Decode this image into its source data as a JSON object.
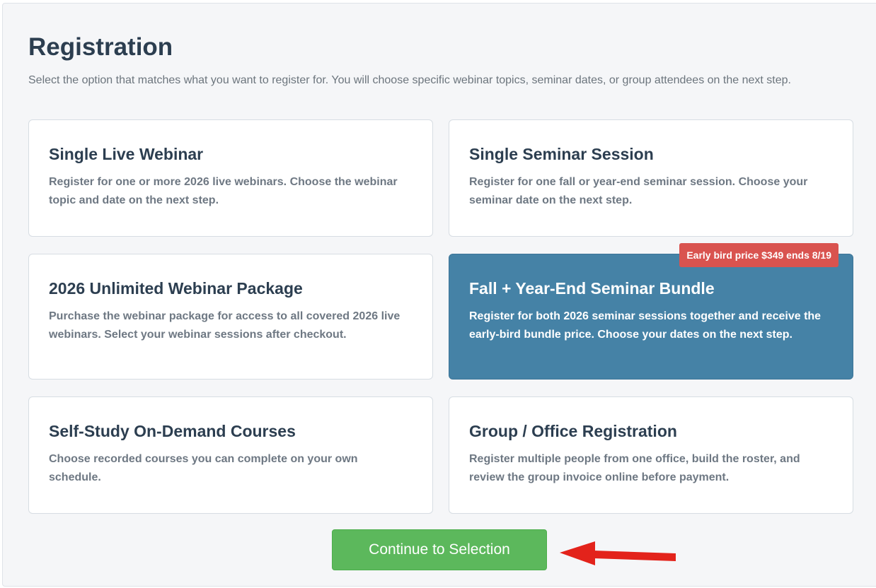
{
  "page": {
    "title": "Registration",
    "intro": "Select the option that matches what you want to register for. You will choose specific webinar topics, seminar dates, or group attendees on the next step."
  },
  "options": [
    {
      "title": "Single Live Webinar",
      "description": "Register for one or more 2026 live webinars. Choose the webinar topic and date on the next step.",
      "selected": false
    },
    {
      "title": "Single Seminar Session",
      "description": "Register for one fall or year-end seminar session. Choose your seminar date on the next step.",
      "selected": false
    },
    {
      "title": "2026 Unlimited Webinar Package",
      "description": "Purchase the webinar package for access to all covered 2026 live webinars. Select your webinar sessions after checkout.",
      "selected": false
    },
    {
      "title": "Fall + Year-End Seminar Bundle",
      "description": "Register for both 2026 seminar sessions together and receive the early-bird bundle price. Choose your dates on the next step.",
      "badge": "Early bird price $349 ends 8/19",
      "selected": true
    },
    {
      "title": "Self-Study On-Demand Courses",
      "description": "Choose recorded courses you can complete on your own schedule.",
      "selected": false
    },
    {
      "title": "Group / Office Registration",
      "description": "Register multiple people from one office, build the roster, and review the group invoice online before payment.",
      "selected": false
    }
  ],
  "actions": {
    "continue_label": "Continue to Selection"
  },
  "colors": {
    "selected_card": "#4582a6",
    "badge": "#d9534f",
    "continue_button": "#5cb85c",
    "annotation_arrow": "#e3231b"
  },
  "annotation": {
    "icon": "red-arrow-left-icon"
  }
}
